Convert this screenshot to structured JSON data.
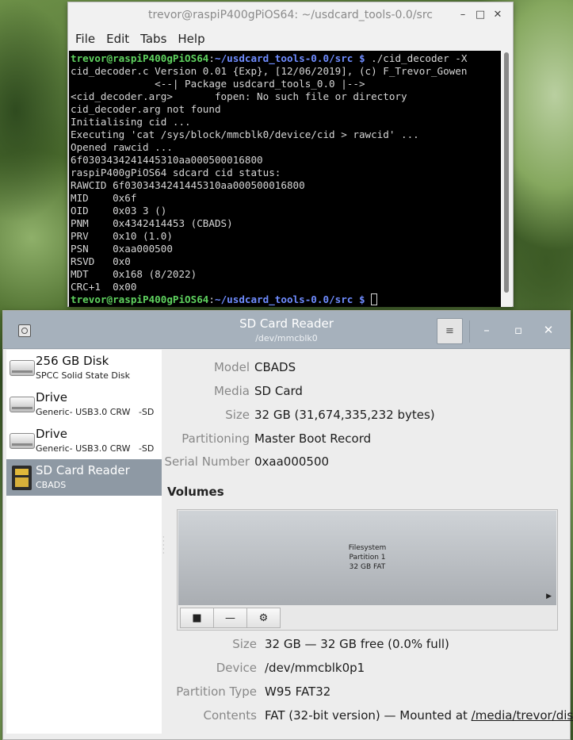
{
  "terminal": {
    "title": "trevor@raspiP400gPiOS64: ~/usdcard_tools-0.0/src",
    "controls": {
      "minimize": "–",
      "maximize": "□",
      "close": "✕"
    },
    "menu": [
      "File",
      "Edit",
      "Tabs",
      "Help"
    ],
    "prompt_user": "trevor@raspiP400gPiOS64",
    "prompt_sep": ":",
    "prompt_path": "~/usdcard_tools-0.0/src $",
    "command": " ./cid_decoder -X",
    "lines": [
      "cid_decoder.c Version 0.01 {Exp}, [12/06/2019], (c) F_Trevor_Gowen",
      "              <--| Package usdcard_tools_0.0 |-->",
      "<cid_decoder.arg>       fopen: No such file or directory",
      "cid_decoder.arg not found",
      "Initialising cid ...",
      "Executing 'cat /sys/block/mmcblk0/device/cid > rawcid' ...",
      "Opened rawcid ...",
      "6f0303434241445310aa000500016800",
      "raspiP400gPiOS64 sdcard cid status:",
      "RAWCID 6f0303434241445310aa000500016800",
      "MID    0x6f",
      "OID    0x03 3 ()",
      "PNM    0x4342414453 (CBADS)",
      "PRV    0x10 (1.0)",
      "PSN    0xaa000500",
      "RSVD   0x0",
      "MDT    0x168 (8/2022)",
      "CRC+1  0x00"
    ]
  },
  "disks": {
    "title": "SD Card Reader",
    "subtitle": "/dev/mmcblk0",
    "menu_icon": "≡",
    "controls": {
      "minimize": "–",
      "maximize": "▫",
      "close": "✕"
    },
    "drives": [
      {
        "name": "256 GB Disk",
        "desc": "SPCC Solid State Disk",
        "icon": "drive-icon"
      },
      {
        "name": "Drive",
        "desc": "Generic- USB3.0 CRW   -SD",
        "icon": "drive-icon"
      },
      {
        "name": "Drive",
        "desc": "Generic- USB3.0 CRW   -SD",
        "icon": "drive-icon"
      },
      {
        "name": "SD Card Reader",
        "desc": "CBADS",
        "icon": "sd-card-icon",
        "selected": true
      }
    ],
    "details": [
      {
        "key": "Model",
        "value": "CBADS"
      },
      {
        "key": "Media",
        "value": "SD Card"
      },
      {
        "key": "Size",
        "value": "32 GB (31,674,335,232 bytes)"
      },
      {
        "key": "Partitioning",
        "value": "Master Boot Record"
      },
      {
        "key": "Serial Number",
        "value": "0xaa000500"
      }
    ],
    "volumes_title": "Volumes",
    "volume": {
      "label_line1": "Filesystem",
      "label_line2": "Partition 1",
      "label_line3": "32 GB FAT",
      "tools": [
        "■",
        "—",
        "⚙"
      ]
    },
    "volume_details": [
      {
        "key": "Size",
        "value": "32 GB — 32 GB free (0.0% full)"
      },
      {
        "key": "Device",
        "value": "/dev/mmcblk0p1"
      },
      {
        "key": "Partition Type",
        "value": "W95 FAT32"
      },
      {
        "key": "Contents",
        "value": "FAT (32-bit version) — Mounted at ",
        "link": "/media/trevor/disk"
      }
    ]
  }
}
